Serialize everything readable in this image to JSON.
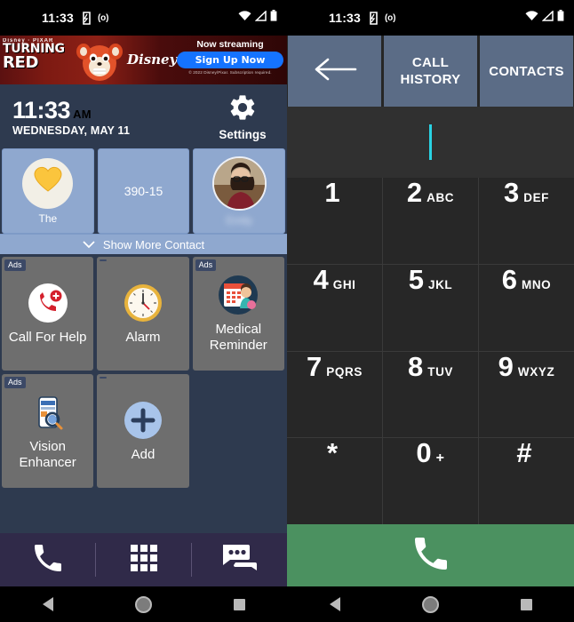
{
  "status_bar": {
    "time": "11:33",
    "sim_label": "(o)",
    "icons": [
      "vibrate-icon",
      "wifi-icon",
      "signal-icon",
      "battery-icon"
    ]
  },
  "left_screen": {
    "ad_banner": {
      "studio": "Disney · PIXAR",
      "title_line1": "TURNING",
      "title_line2": "RED",
      "brand": "Disney+",
      "headline": "Now streaming",
      "cta": "Sign Up Now",
      "fine_print": "© 2022 Disney/Pixar. Subscription required."
    },
    "clock": {
      "time": "11:33",
      "ampm": "AM",
      "date": "WEDNESDAY, MAY 11"
    },
    "settings": {
      "label": "Settings",
      "icon": "gear-icon"
    },
    "contacts": [
      {
        "name": "The",
        "type": "emoji",
        "glyph": "💛",
        "blurred": false
      },
      {
        "name": "390-15",
        "type": "number",
        "blurred": false
      },
      {
        "name": "Emily",
        "type": "photo",
        "blurred": true
      }
    ],
    "show_more": {
      "label": "Show More Contact",
      "icon": "chevron-down-icon"
    },
    "apps": [
      {
        "label": "Call For Help",
        "ads": "Ads",
        "icon": "emergency-call-icon"
      },
      {
        "label": "Alarm",
        "ads": "",
        "icon": "alarm-clock-icon"
      },
      {
        "label": "Medical Reminder",
        "ads": "Ads",
        "icon": "medical-calendar-icon"
      },
      {
        "label": "Vision Enhancer",
        "ads": "Ads",
        "icon": "magnifier-phone-icon"
      },
      {
        "label": "Add",
        "ads": "",
        "icon": "plus-circle-icon"
      }
    ],
    "bottom_nav": [
      {
        "name": "phone-icon"
      },
      {
        "name": "apps-grid-icon"
      },
      {
        "name": "messages-icon"
      }
    ]
  },
  "right_screen": {
    "header": {
      "back_icon": "arrow-left-icon",
      "call_history": "CALL HISTORY",
      "contacts": "CONTACTS"
    },
    "number_input": {
      "value": "",
      "caret_color": "#29d2e3"
    },
    "keys": [
      {
        "num": "1",
        "sub": ""
      },
      {
        "num": "2",
        "sub": "ABC"
      },
      {
        "num": "3",
        "sub": "DEF"
      },
      {
        "num": "4",
        "sub": "GHI"
      },
      {
        "num": "5",
        "sub": "JKL"
      },
      {
        "num": "6",
        "sub": "MNO"
      },
      {
        "num": "7",
        "sub": "PQRS"
      },
      {
        "num": "8",
        "sub": "TUV"
      },
      {
        "num": "9",
        "sub": "WXYZ"
      },
      {
        "num": "*",
        "sub": ""
      },
      {
        "num": "0",
        "sub": "+"
      },
      {
        "num": "#",
        "sub": ""
      }
    ],
    "call_button": {
      "icon": "phone-icon",
      "color": "#4b9160"
    }
  },
  "android_nav": [
    "back-triangle-icon",
    "home-circle-icon",
    "recents-square-icon"
  ]
}
